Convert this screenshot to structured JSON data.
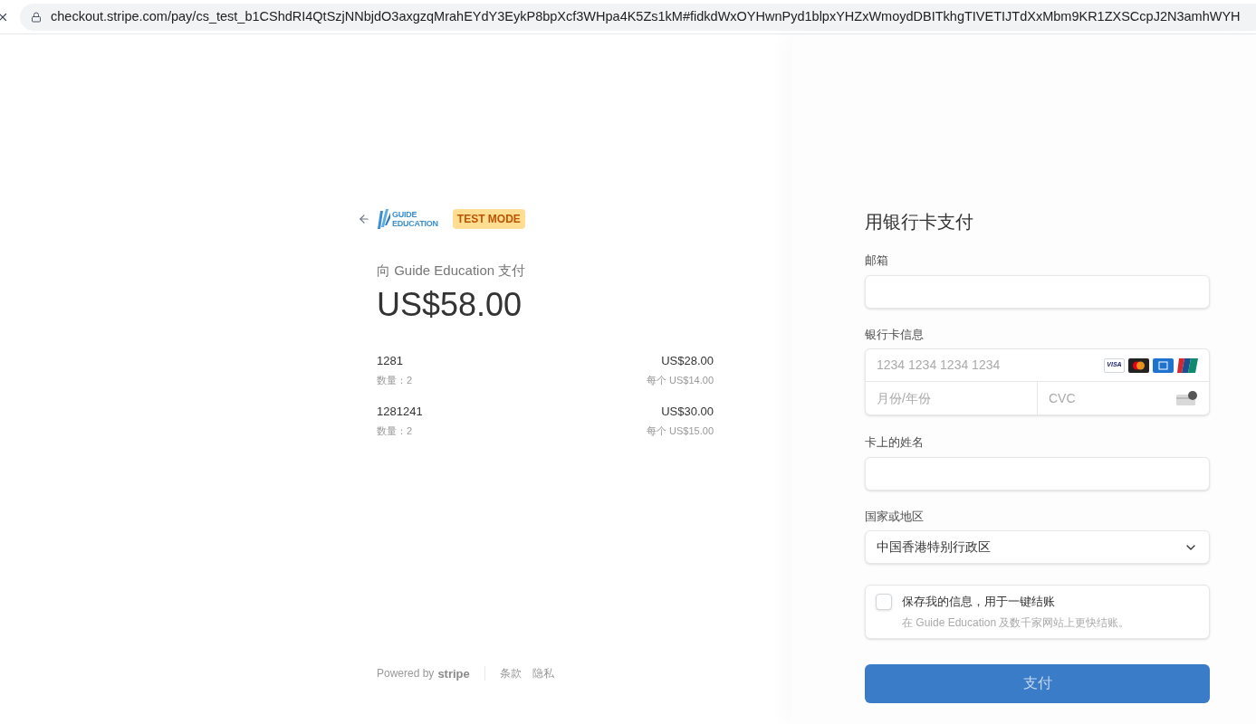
{
  "browser": {
    "url": "checkout.stripe.com/pay/cs_test_b1CShdRI4QtSzjNNbjdO3axgzqMrahEYdY3EykP8bpXcf3WHpa4K5Zs1kM#fidkdWxOYHwnPyd1blpxYHZxWmoydDBITkhgTIVETIJTdXxMbm9KR1ZXSCcpJ2N3amhWYH"
  },
  "merchant": {
    "logo_line_1": "GUIDE",
    "logo_line_2": "EDUCATION",
    "badge": "TEST MODE",
    "pay_to": "向 Guide Education 支付",
    "total": "US$58.00"
  },
  "line_items": [
    {
      "name": "1281",
      "quantity": "数量：2",
      "amount": "US$28.00",
      "unit_price": "每个 US$14.00"
    },
    {
      "name": "1281241",
      "quantity": "数量：2",
      "amount": "US$30.00",
      "unit_price": "每个 US$15.00"
    }
  ],
  "footer": {
    "powered_by": "Powered by",
    "brand": "stripe",
    "links": [
      "条款",
      "隐私"
    ]
  },
  "form": {
    "title": "用银行卡支付",
    "email": {
      "label": "邮箱"
    },
    "card": {
      "label": "银行卡信息",
      "number_placeholder": "1234 1234 1234 1234",
      "expiry_placeholder": "月份/年份",
      "cvc_placeholder": "CVC",
      "brands": [
        {
          "kind": "visa",
          "label": "VISA"
        },
        {
          "kind": "mastercard"
        },
        {
          "kind": "amex"
        },
        {
          "kind": "unionpay"
        }
      ]
    },
    "name": {
      "label": "卡上的姓名"
    },
    "country": {
      "label": "国家或地区",
      "value": "中国香港特别行政区"
    },
    "save_info": {
      "checked": false,
      "title": "保存我的信息，用于一键结账",
      "description": "在 Guide Education 及数千家网站上更快结账。"
    },
    "submit": {
      "label": "支付",
      "disabled": true
    }
  }
}
